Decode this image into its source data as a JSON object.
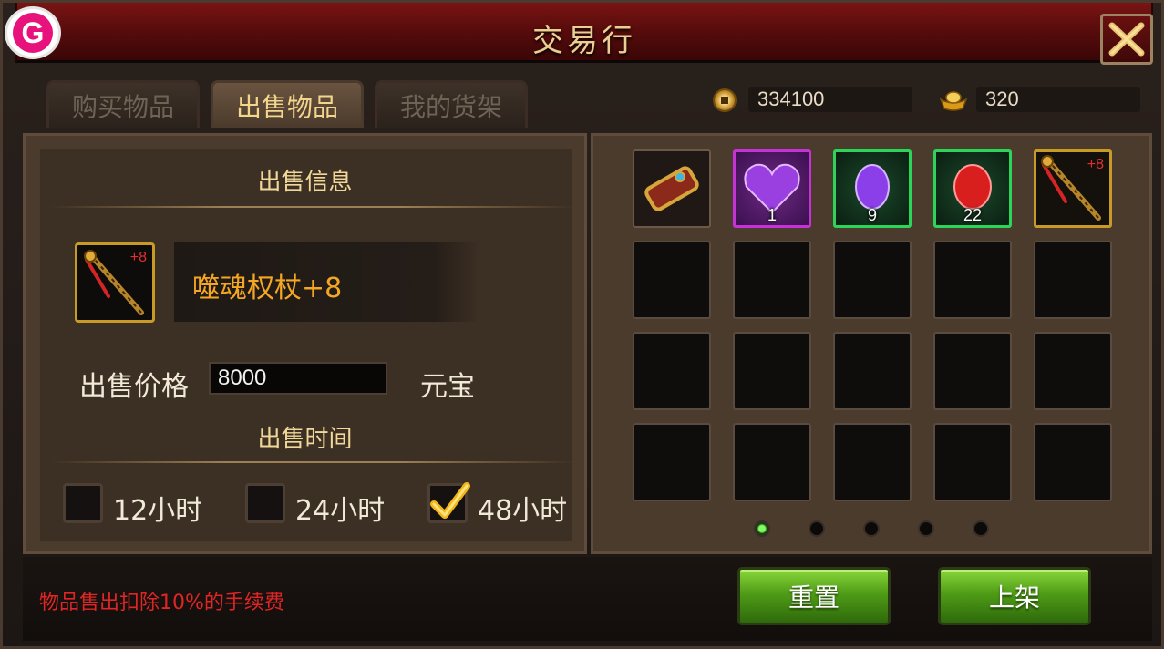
{
  "window": {
    "title": "交易行"
  },
  "tabs": [
    {
      "label": "购买物品",
      "active": false
    },
    {
      "label": "出售物品",
      "active": true
    },
    {
      "label": "我的货架",
      "active": false
    }
  ],
  "currency": {
    "coins": "334100",
    "gold_ingots": "320"
  },
  "sell_info": {
    "section_title": "出售信息",
    "item_name": "噬魂权杖+8",
    "item_enhance": "+8",
    "price_label": "出售价格",
    "price_value": "8000",
    "price_unit": "元宝",
    "time_title": "出售时间",
    "time_options": [
      {
        "label": "12小时",
        "checked": false
      },
      {
        "label": "24小时",
        "checked": false
      },
      {
        "label": "48小时",
        "checked": true
      }
    ]
  },
  "inventory": {
    "items": [
      {
        "icon": "scroll-icon",
        "qty": ""
      },
      {
        "icon": "purple-heart-gem-icon",
        "qty": "1"
      },
      {
        "icon": "purple-gem-icon",
        "qty": "9"
      },
      {
        "icon": "red-gem-icon",
        "qty": "22"
      },
      {
        "icon": "scepter-icon",
        "enhance": "+8"
      }
    ],
    "pages": 5,
    "current_page": 1
  },
  "footer": {
    "notice": "物品售出扣除10%的手续费",
    "reset_label": "重置",
    "list_label": "上架"
  },
  "colors": {
    "title_red": "#5a0c0c",
    "accent_gold": "#f1d899",
    "item_orange": "#f5a623",
    "notice_red": "#e02525",
    "button_green": "#4f9c17"
  }
}
